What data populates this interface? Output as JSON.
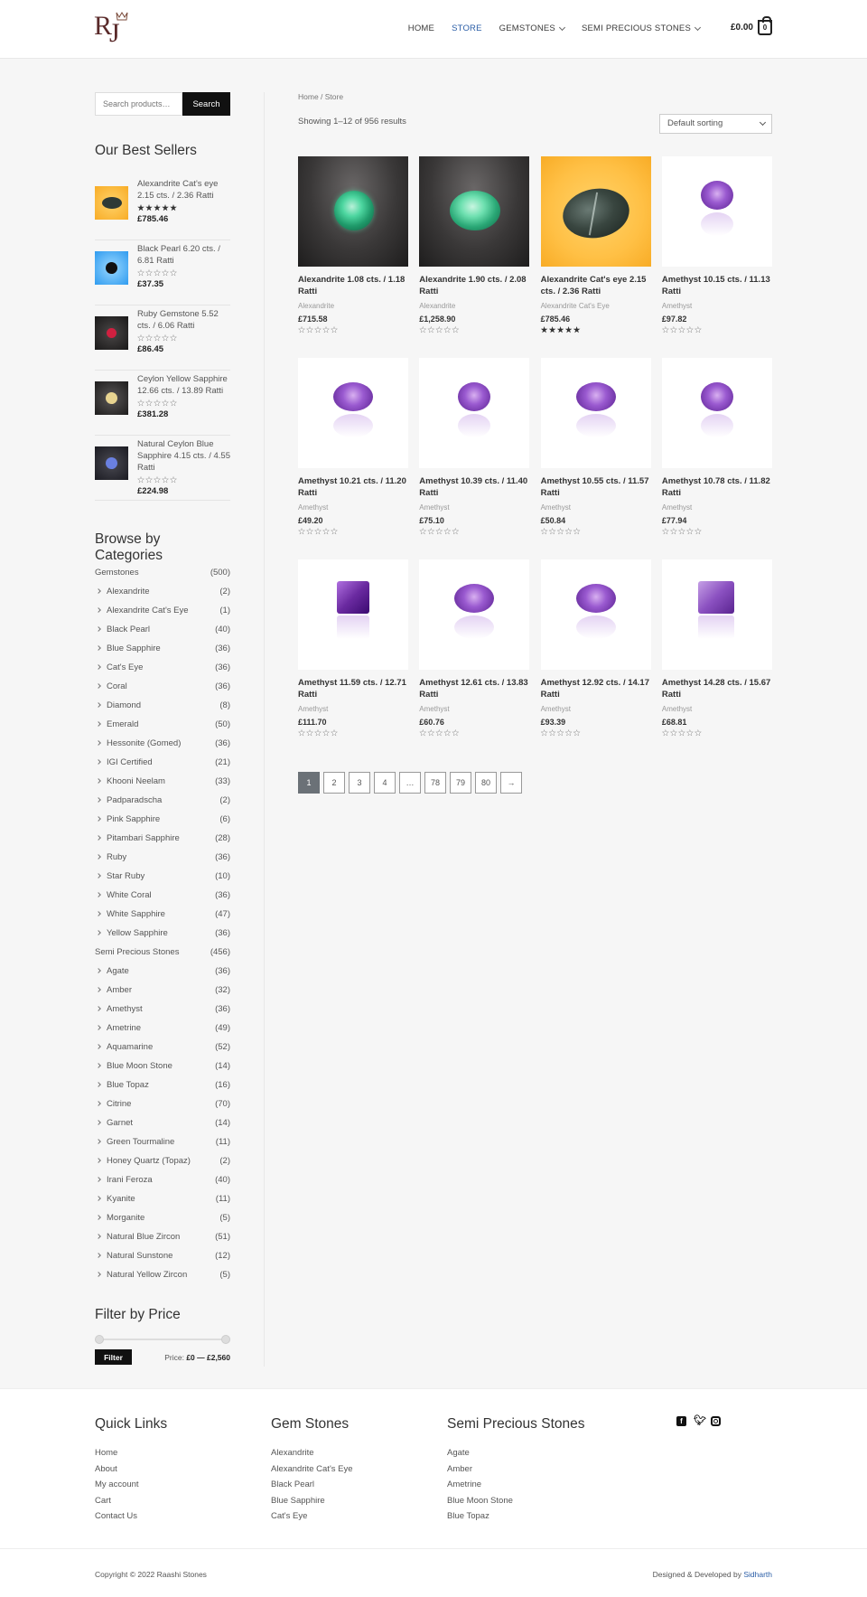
{
  "header": {
    "logo_text": "RJ",
    "nav": [
      {
        "label": "HOME",
        "active": false,
        "dropdown": false
      },
      {
        "label": "STORE",
        "active": true,
        "dropdown": false
      },
      {
        "label": "GEMSTONES",
        "active": false,
        "dropdown": true
      },
      {
        "label": "SEMI PRECIOUS STONES",
        "active": false,
        "dropdown": true
      }
    ],
    "cart_total": "£0.00",
    "cart_count": "0"
  },
  "sidebar": {
    "search_placeholder": "Search products…",
    "search_button": "Search",
    "best_sellers_title": "Our Best Sellers",
    "best_sellers": [
      {
        "name": "Alexandrite Cat's eye 2.15 cts. / 2.36 Ratti",
        "price": "£785.46",
        "rating": 5
      },
      {
        "name": "Black Pearl 6.20 cts. / 6.81 Ratti",
        "price": "£37.35",
        "rating": 0
      },
      {
        "name": "Ruby Gemstone 5.52 cts. / 6.06 Ratti",
        "price": "£86.45",
        "rating": 0
      },
      {
        "name": "Ceylon Yellow Sapphire 12.66 cts. / 13.89 Ratti",
        "price": "£381.28",
        "rating": 0
      },
      {
        "name": "Natural Ceylon Blue Sapphire 4.15 cts. / 4.55 Ratti",
        "price": "£224.98",
        "rating": 0
      }
    ],
    "categories_title": "Browse by Categories",
    "categories": [
      {
        "name": "Gemstones",
        "count": "(500)",
        "sub": false
      },
      {
        "name": "Alexandrite",
        "count": "(2)",
        "sub": true
      },
      {
        "name": "Alexandrite Cat's Eye",
        "count": "(1)",
        "sub": true
      },
      {
        "name": "Black Pearl",
        "count": "(40)",
        "sub": true
      },
      {
        "name": "Blue Sapphire",
        "count": "(36)",
        "sub": true
      },
      {
        "name": "Cat's Eye",
        "count": "(36)",
        "sub": true
      },
      {
        "name": "Coral",
        "count": "(36)",
        "sub": true
      },
      {
        "name": "Diamond",
        "count": "(8)",
        "sub": true
      },
      {
        "name": "Emerald",
        "count": "(50)",
        "sub": true
      },
      {
        "name": "Hessonite (Gomed)",
        "count": "(36)",
        "sub": true
      },
      {
        "name": "IGI Certified",
        "count": "(21)",
        "sub": true
      },
      {
        "name": "Khooni Neelam",
        "count": "(33)",
        "sub": true
      },
      {
        "name": "Padparadscha",
        "count": "(2)",
        "sub": true
      },
      {
        "name": "Pink Sapphire",
        "count": "(6)",
        "sub": true
      },
      {
        "name": "Pitambari Sapphire",
        "count": "(28)",
        "sub": true
      },
      {
        "name": "Ruby",
        "count": "(36)",
        "sub": true
      },
      {
        "name": "Star Ruby",
        "count": "(10)",
        "sub": true
      },
      {
        "name": "White Coral",
        "count": "(36)",
        "sub": true
      },
      {
        "name": "White Sapphire",
        "count": "(47)",
        "sub": true
      },
      {
        "name": "Yellow Sapphire",
        "count": "(36)",
        "sub": true
      },
      {
        "name": "Semi Precious Stones",
        "count": "(456)",
        "sub": false
      },
      {
        "name": "Agate",
        "count": "(36)",
        "sub": true
      },
      {
        "name": "Amber",
        "count": "(32)",
        "sub": true
      },
      {
        "name": "Amethyst",
        "count": "(36)",
        "sub": true
      },
      {
        "name": "Ametrine",
        "count": "(49)",
        "sub": true
      },
      {
        "name": "Aquamarine",
        "count": "(52)",
        "sub": true
      },
      {
        "name": "Blue Moon Stone",
        "count": "(14)",
        "sub": true
      },
      {
        "name": "Blue Topaz",
        "count": "(16)",
        "sub": true
      },
      {
        "name": "Citrine",
        "count": "(70)",
        "sub": true
      },
      {
        "name": "Garnet",
        "count": "(14)",
        "sub": true
      },
      {
        "name": "Green Tourmaline",
        "count": "(11)",
        "sub": true
      },
      {
        "name": "Honey Quartz (Topaz)",
        "count": "(2)",
        "sub": true
      },
      {
        "name": "Irani Feroza",
        "count": "(40)",
        "sub": true
      },
      {
        "name": "Kyanite",
        "count": "(11)",
        "sub": true
      },
      {
        "name": "Morganite",
        "count": "(5)",
        "sub": true
      },
      {
        "name": "Natural Blue Zircon",
        "count": "(51)",
        "sub": true
      },
      {
        "name": "Natural Sunstone",
        "count": "(12)",
        "sub": true
      },
      {
        "name": "Natural Yellow Zircon",
        "count": "(5)",
        "sub": true
      }
    ],
    "price_filter_title": "Filter by Price",
    "filter_button": "Filter",
    "price_label": "Price:",
    "price_range": "£0 — £2,560"
  },
  "main": {
    "breadcrumb": "Home / Store",
    "result_count": "Showing 1–12 of 956 results",
    "sort_selected": "Default sorting",
    "products": [
      {
        "name": "Alexandrite 1.08 cts. / 1.18 Ratti",
        "category": "Alexandrite",
        "price": "£715.58",
        "rating": 0,
        "image": "green-round"
      },
      {
        "name": "Alexandrite 1.90 cts. / 2.08 Ratti",
        "category": "Alexandrite",
        "price": "£1,258.90",
        "rating": 0,
        "image": "green-oval"
      },
      {
        "name": "Alexandrite Cat's eye 2.15 cts. / 2.36 Ratti",
        "category": "Alexandrite Cat's Eye",
        "price": "£785.46",
        "rating": 5,
        "image": "catseye"
      },
      {
        "name": "Amethyst 10.15 cts. / 11.13 Ratti",
        "category": "Amethyst",
        "price": "£97.82",
        "rating": 0,
        "image": "amethyst-round"
      },
      {
        "name": "Amethyst 10.21 cts. / 11.20 Ratti",
        "category": "Amethyst",
        "price": "£49.20",
        "rating": 0,
        "image": "amethyst-oval"
      },
      {
        "name": "Amethyst 10.39 cts. / 11.40 Ratti",
        "category": "Amethyst",
        "price": "£75.10",
        "rating": 0,
        "image": "amethyst-round"
      },
      {
        "name": "Amethyst 10.55 cts. / 11.57 Ratti",
        "category": "Amethyst",
        "price": "£50.84",
        "rating": 0,
        "image": "amethyst-oval"
      },
      {
        "name": "Amethyst 10.78 cts. / 11.82 Ratti",
        "category": "Amethyst",
        "price": "£77.94",
        "rating": 0,
        "image": "amethyst-round"
      },
      {
        "name": "Amethyst 11.59 cts. / 12.71 Ratti",
        "category": "Amethyst",
        "price": "£111.70",
        "rating": 0,
        "image": "amethyst-square"
      },
      {
        "name": "Amethyst 12.61 cts. / 13.83 Ratti",
        "category": "Amethyst",
        "price": "£60.76",
        "rating": 0,
        "image": "amethyst-oval"
      },
      {
        "name": "Amethyst 12.92 cts. / 14.17 Ratti",
        "category": "Amethyst",
        "price": "£93.39",
        "rating": 0,
        "image": "amethyst-oval"
      },
      {
        "name": "Amethyst 14.28 cts. / 15.67 Ratti",
        "category": "Amethyst",
        "price": "£68.81",
        "rating": 0,
        "image": "amethyst-square2"
      }
    ],
    "pagination": [
      "1",
      "2",
      "3",
      "4",
      "…",
      "78",
      "79",
      "80",
      "→"
    ]
  },
  "footer": {
    "quick_links_title": "Quick Links",
    "quick_links": [
      "Home",
      "About",
      "My account",
      "Cart",
      "Contact Us"
    ],
    "gem_stones_title": "Gem Stones",
    "gem_stones": [
      "Alexandrite",
      "Alexandrite Cat's Eye",
      "Black Pearl",
      "Blue Sapphire",
      "Cat's Eye"
    ],
    "semi_precious_title": "Semi Precious Stones",
    "semi_precious": [
      "Agate",
      "Amber",
      "Ametrine",
      "Blue Moon Stone",
      "Blue Topaz"
    ],
    "social": [
      "facebook-icon",
      "twitter-icon",
      "instagram-icon"
    ],
    "copyright": "Copyright © 2022 Raashi Stones",
    "credit_prefix": "Designed & Developed by",
    "credit_name": "Sidharth"
  },
  "colors": {
    "accent": "#2b5ea7",
    "button_dark": "#111111",
    "page_active": "#6b7177"
  }
}
